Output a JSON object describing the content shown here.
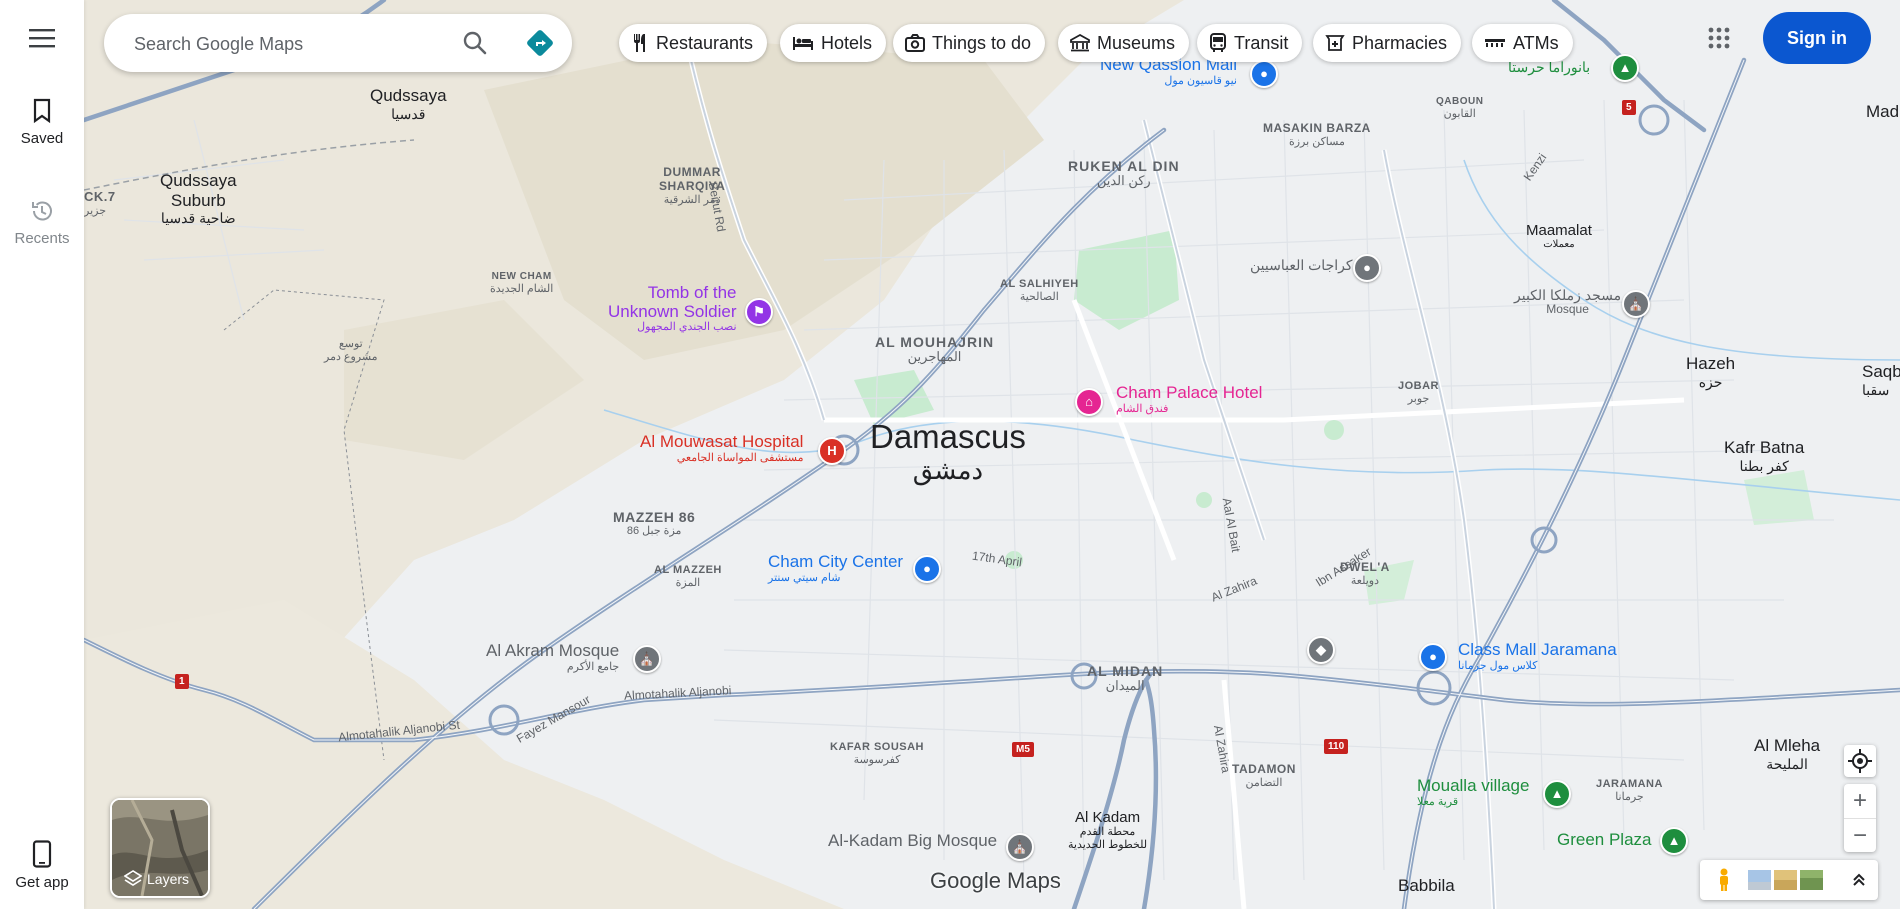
{
  "rail": {
    "saved_label": "Saved",
    "recents_label": "Recents",
    "get_app_label": "Get app"
  },
  "search": {
    "placeholder": "Search Google Maps"
  },
  "chips": [
    {
      "label": "Restaurants",
      "icon": "fork-knife-icon"
    },
    {
      "label": "Hotels",
      "icon": "bed-icon"
    },
    {
      "label": "Things to do",
      "icon": "camera-icon"
    },
    {
      "label": "Museums",
      "icon": "museum-icon"
    },
    {
      "label": "Transit",
      "icon": "bus-icon"
    },
    {
      "label": "Pharmacies",
      "icon": "pharmacy-icon"
    },
    {
      "label": "ATMs",
      "icon": "atm-icon"
    }
  ],
  "header": {
    "sign_in_label": "Sign in"
  },
  "layers": {
    "label": "Layers"
  },
  "watermark": "Google Maps",
  "city": {
    "en": "Damascus",
    "ar": "دمشق"
  },
  "neighborhoods": [
    {
      "id": "ruken",
      "en": "RUKEN AL DIN",
      "ar": "ركن الدين"
    },
    {
      "id": "mouhajrin",
      "en": "AL MOUHAJRIN",
      "ar": "المهاجرين"
    },
    {
      "id": "midan",
      "en": "AL MIDAN",
      "ar": "الميدان"
    },
    {
      "id": "mazzeh86",
      "en": "MAZZEH 86",
      "ar": "مزة جبل 86"
    },
    {
      "id": "dummar",
      "en": "DUMMAR\nSHARQIYA",
      "ar": "دمر الشرقية"
    },
    {
      "id": "masakin",
      "en": "MASAKIN BARZA",
      "ar": "مساكن برزة"
    },
    {
      "id": "salhiyeh",
      "en": "AL SALHIYEH",
      "ar": "الصالحية"
    },
    {
      "id": "jobar",
      "en": "JOBAR",
      "ar": "جوبر"
    },
    {
      "id": "dwela",
      "en": "DWEL'A",
      "ar": "دويلعة"
    },
    {
      "id": "mazzeh",
      "en": "AL MAZZEH",
      "ar": "المزة"
    },
    {
      "id": "kafar",
      "en": "KAFAR SOUSAH",
      "ar": "كفرسوسة"
    },
    {
      "id": "tadamon",
      "en": "TADAMON",
      "ar": "التضامن"
    },
    {
      "id": "newcham",
      "en": "NEW CHAM",
      "ar": "الشام الجديدة"
    },
    {
      "id": "qaboun",
      "en": "QABOUN",
      "ar": "القابون"
    },
    {
      "id": "jaramana",
      "en": "JARAMANA",
      "ar": "جرمانا"
    }
  ],
  "towns": [
    {
      "id": "qudssaya",
      "en": "Qudssaya",
      "ar": "قدسيا"
    },
    {
      "id": "qsuburb",
      "en": "Qudssaya\nSuburb",
      "ar": "ضاحية قدسيا"
    },
    {
      "id": "hazeh",
      "en": "Hazeh",
      "ar": "حزه"
    },
    {
      "id": "kafrbatna",
      "en": "Kafr Batna",
      "ar": "كفر بطنا"
    },
    {
      "id": "mleha",
      "en": "Al Mleha",
      "ar": "المليحة"
    },
    {
      "id": "kadam",
      "en": "Al Kadam",
      "ar": "محطة القدم\nللخطوط الحديدية"
    },
    {
      "id": "babbila",
      "en": "Babbila",
      "ar": ""
    },
    {
      "id": "saqba",
      "en": "Saqb",
      "ar": "سقبا"
    },
    {
      "id": "mad",
      "en": "Mad",
      "ar": ""
    },
    {
      "id": "ck7",
      "en": "CK.7",
      "ar": "جزير"
    },
    {
      "id": "tawsee",
      "en": "توسع\nمشروع دمر",
      "ar": ""
    },
    {
      "id": "maamalat",
      "en": "Maamalat",
      "ar": "معملات"
    }
  ],
  "pois": [
    {
      "id": "tomb",
      "en": "Tomb of the\nUnknown Soldier",
      "ar": "نصب الجندي المجهول",
      "color": "#9334e6"
    },
    {
      "id": "chamPalace",
      "en": "Cham Palace Hotel",
      "ar": "فندق الشام",
      "color": "#e52592"
    },
    {
      "id": "mouwasat",
      "en": "Al Mouwasat Hospital",
      "ar": "مستشفى المواساة الجامعي",
      "color": "#d93025"
    },
    {
      "id": "chamCity",
      "en": "Cham City Center",
      "ar": "شام سيتي سنتر",
      "color": "#1a73e8"
    },
    {
      "id": "akram",
      "en": "Al Akram Mosque",
      "ar": "جامع الأكرم",
      "color": "#5f6368"
    },
    {
      "id": "classMall",
      "en": "Class Mall Jaramana",
      "ar": "كلاس مول جرمانا",
      "color": "#1a73e8"
    },
    {
      "id": "moualla",
      "en": "Moualla village",
      "ar": "قرية معلا",
      "color": "#1e8e3e"
    },
    {
      "id": "greenPlaza",
      "en": "Green Plaza",
      "ar": "",
      "color": "#1e8e3e"
    },
    {
      "id": "kadamMosque",
      "en": "Al-Kadam Big Mosque",
      "ar": "",
      "color": "#5f6368"
    },
    {
      "id": "qassion",
      "en": "New Qassion Mall",
      "ar": "نيو قاسيون مول",
      "color": "#1a73e8"
    },
    {
      "id": "abbasiyin",
      "en": "كراجات العباسيين",
      "ar": "",
      "color": "#5f6368"
    },
    {
      "id": "zamalka",
      "en": "مسجد زملكا الكبير",
      "ar": "Mosque",
      "color": "#5f6368"
    },
    {
      "id": "baranoramaa",
      "en": "بانوراما حرستا",
      "ar": "",
      "color": "#1e8e3e"
    }
  ],
  "roads": [
    {
      "id": "beirut",
      "text": "Beirut Rd"
    },
    {
      "id": "april",
      "text": "17th April"
    },
    {
      "id": "albait",
      "text": "Aal Al Bait"
    },
    {
      "id": "ibnassaker",
      "text": "Ibn Assaker"
    },
    {
      "id": "zahira",
      "text": "Al Zahira"
    },
    {
      "id": "zahira2",
      "text": "Al Zahira"
    },
    {
      "id": "motahalik",
      "text": "Almotahalik Aljanobi"
    },
    {
      "id": "motahalik2",
      "text": "Almotahalik Aljanobi St"
    },
    {
      "id": "fayez",
      "text": "Fayez Mansour"
    },
    {
      "id": "kenzi",
      "text": "Kenzi"
    }
  ],
  "shields": [
    {
      "id": "s1",
      "text": "1"
    },
    {
      "id": "s5",
      "text": "5"
    },
    {
      "id": "sm5",
      "text": "M5"
    },
    {
      "id": "s110",
      "text": "110"
    }
  ],
  "colors": {
    "accent": "#0b57d0",
    "map_bg": "#eef0f2",
    "road": "#8ea4c2"
  }
}
